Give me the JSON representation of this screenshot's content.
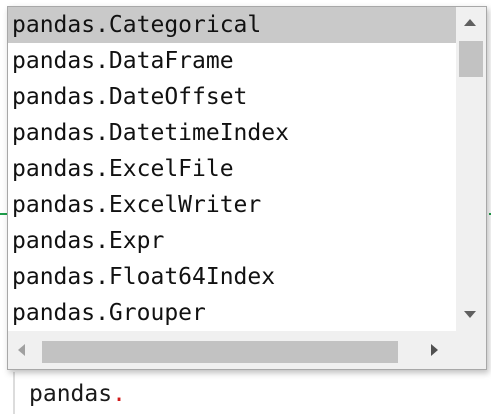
{
  "editor": {
    "code_prefix": "pandas",
    "code_dot": "."
  },
  "autocomplete": {
    "selected_index": 0,
    "items": [
      "pandas.Categorical",
      "pandas.DataFrame",
      "pandas.DateOffset",
      "pandas.DatetimeIndex",
      "pandas.ExcelFile",
      "pandas.ExcelWriter",
      "pandas.Expr",
      "pandas.Float64Index",
      "pandas.Grouper"
    ]
  },
  "icons": {
    "scroll_up": "triangle-up-icon",
    "scroll_down": "triangle-down-icon",
    "scroll_left": "triangle-left-icon",
    "scroll_right": "triangle-right-icon"
  },
  "colors": {
    "selection": "#c9c9c9",
    "dot": "#d11a1a",
    "accent_line": "#1e9e4a"
  }
}
